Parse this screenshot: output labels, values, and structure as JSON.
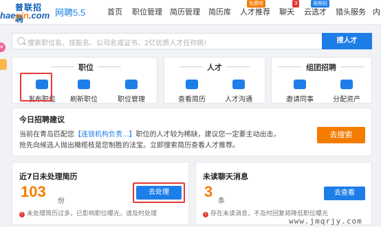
{
  "header": {
    "logo_top": "普联招聘",
    "logo_bottom_a": "hae",
    "logo_bottom_b": "pin",
    "logo_bottom_c": ".com",
    "brand": "网聘5.5",
    "nav": [
      {
        "label": "首页"
      },
      {
        "label": "职位管理"
      },
      {
        "label": "简历管理"
      },
      {
        "label": "简历库"
      },
      {
        "label": "人才推荐",
        "badge": "免费啦"
      },
      {
        "label": "聊天",
        "badge": "3"
      },
      {
        "label": "云选才",
        "badge": "视频招"
      },
      {
        "label": "猎头服务"
      },
      {
        "label": "内"
      }
    ]
  },
  "search": {
    "placeholder": "搜索职位名、技能名、公司名或证书、2亿优质人才任你挑!",
    "button_label": "搜人才"
  },
  "sections": {
    "position": {
      "title": "职位",
      "actions": [
        {
          "label": "发布职位",
          "icon": "send-icon"
        },
        {
          "label": "刷新职位",
          "icon": "refresh-icon"
        },
        {
          "label": "职位管理",
          "icon": "list-icon"
        }
      ]
    },
    "talent": {
      "title": "人才",
      "actions": [
        {
          "label": "查看简历",
          "icon": "resume-icon"
        },
        {
          "label": "人才沟通",
          "icon": "chat-icon"
        }
      ]
    },
    "group": {
      "title": "组团招聘",
      "actions": [
        {
          "label": "邀请同事",
          "icon": "invite-icon"
        },
        {
          "label": "分配资产",
          "icon": "assets-icon"
        }
      ]
    }
  },
  "suggestion": {
    "title": "今日招聘建议",
    "line1_pre": "当前在青岛匹配您",
    "line1_link": "【连锁机构负责...】",
    "line1_post": "职位的人才较为稀缺，建议您一定要主动出击，",
    "line2": "抢先向候选人抛出橄榄枝是您制胜的法宝。立即搜索简历查看人才推荐。",
    "button_label": "去搜索"
  },
  "resumes": {
    "title": "近7日未处理简历",
    "count": "103",
    "unit": "份",
    "button_label": "去处理",
    "warning": "未处理简历过多，已影响职位曝光，请及时处理"
  },
  "chats": {
    "title": "未读聊天消息",
    "count": "3",
    "unit": "条",
    "button_label": "去查看",
    "warning": "存在未读消息，不及时回复将降低职位曝光"
  },
  "watermark": "www.jmqrjy.com",
  "colors": {
    "accent": "#1e7ee8",
    "orange": "#f57c00",
    "highlight": "#e53935"
  }
}
